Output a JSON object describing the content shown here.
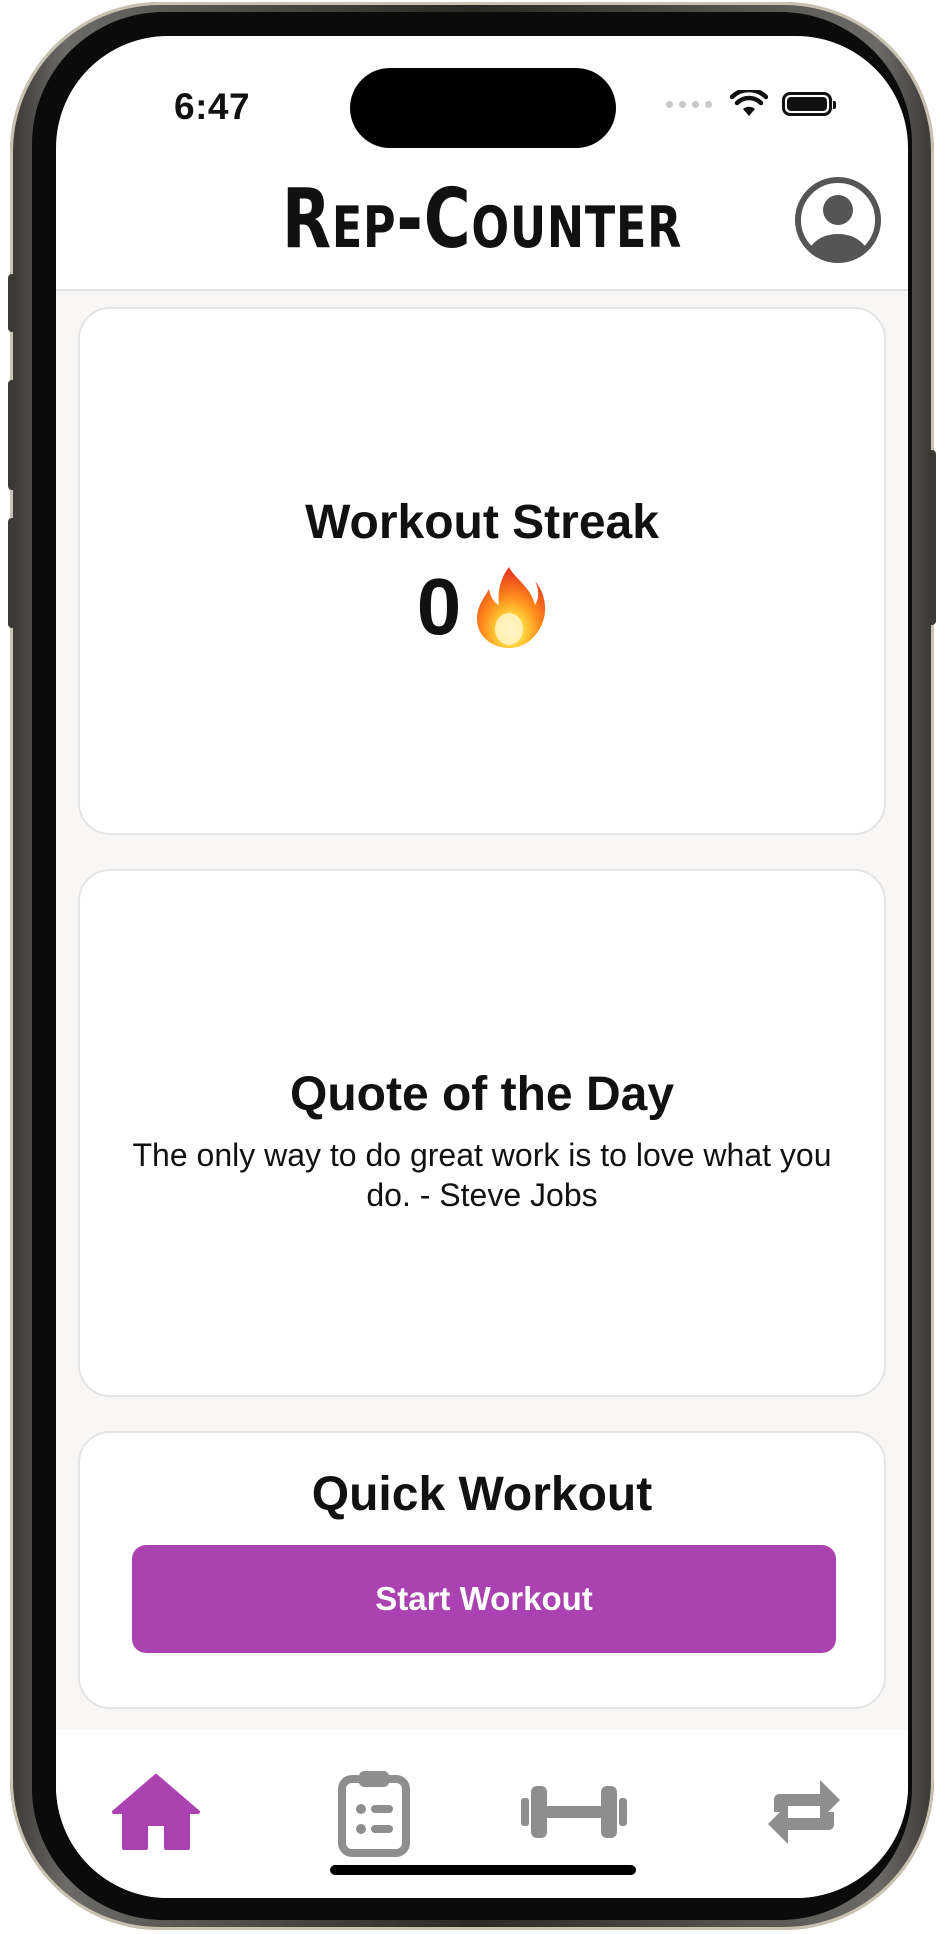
{
  "status_bar": {
    "time": "6:47"
  },
  "header": {
    "title": "Rep-Counter",
    "profile_icon": "person-circle-icon"
  },
  "streak_card": {
    "title": "Workout Streak",
    "value": "0",
    "emoji": "🔥"
  },
  "quote_card": {
    "title": "Quote of the Day",
    "quote": "The only way to do great work is to love what you do. - Steve Jobs"
  },
  "quick_workout_card": {
    "title": "Quick Workout",
    "button_label": "Start Workout"
  },
  "tab_bar": {
    "items": [
      {
        "icon": "home-icon",
        "active": true
      },
      {
        "icon": "clipboard-list-icon",
        "active": false
      },
      {
        "icon": "dumbbell-icon",
        "active": false
      },
      {
        "icon": "repeat-icon",
        "active": false
      }
    ]
  },
  "colors": {
    "accent": "#ab42b1",
    "inactive_icon": "#8e8e8e",
    "background": "#f8f7f5"
  }
}
